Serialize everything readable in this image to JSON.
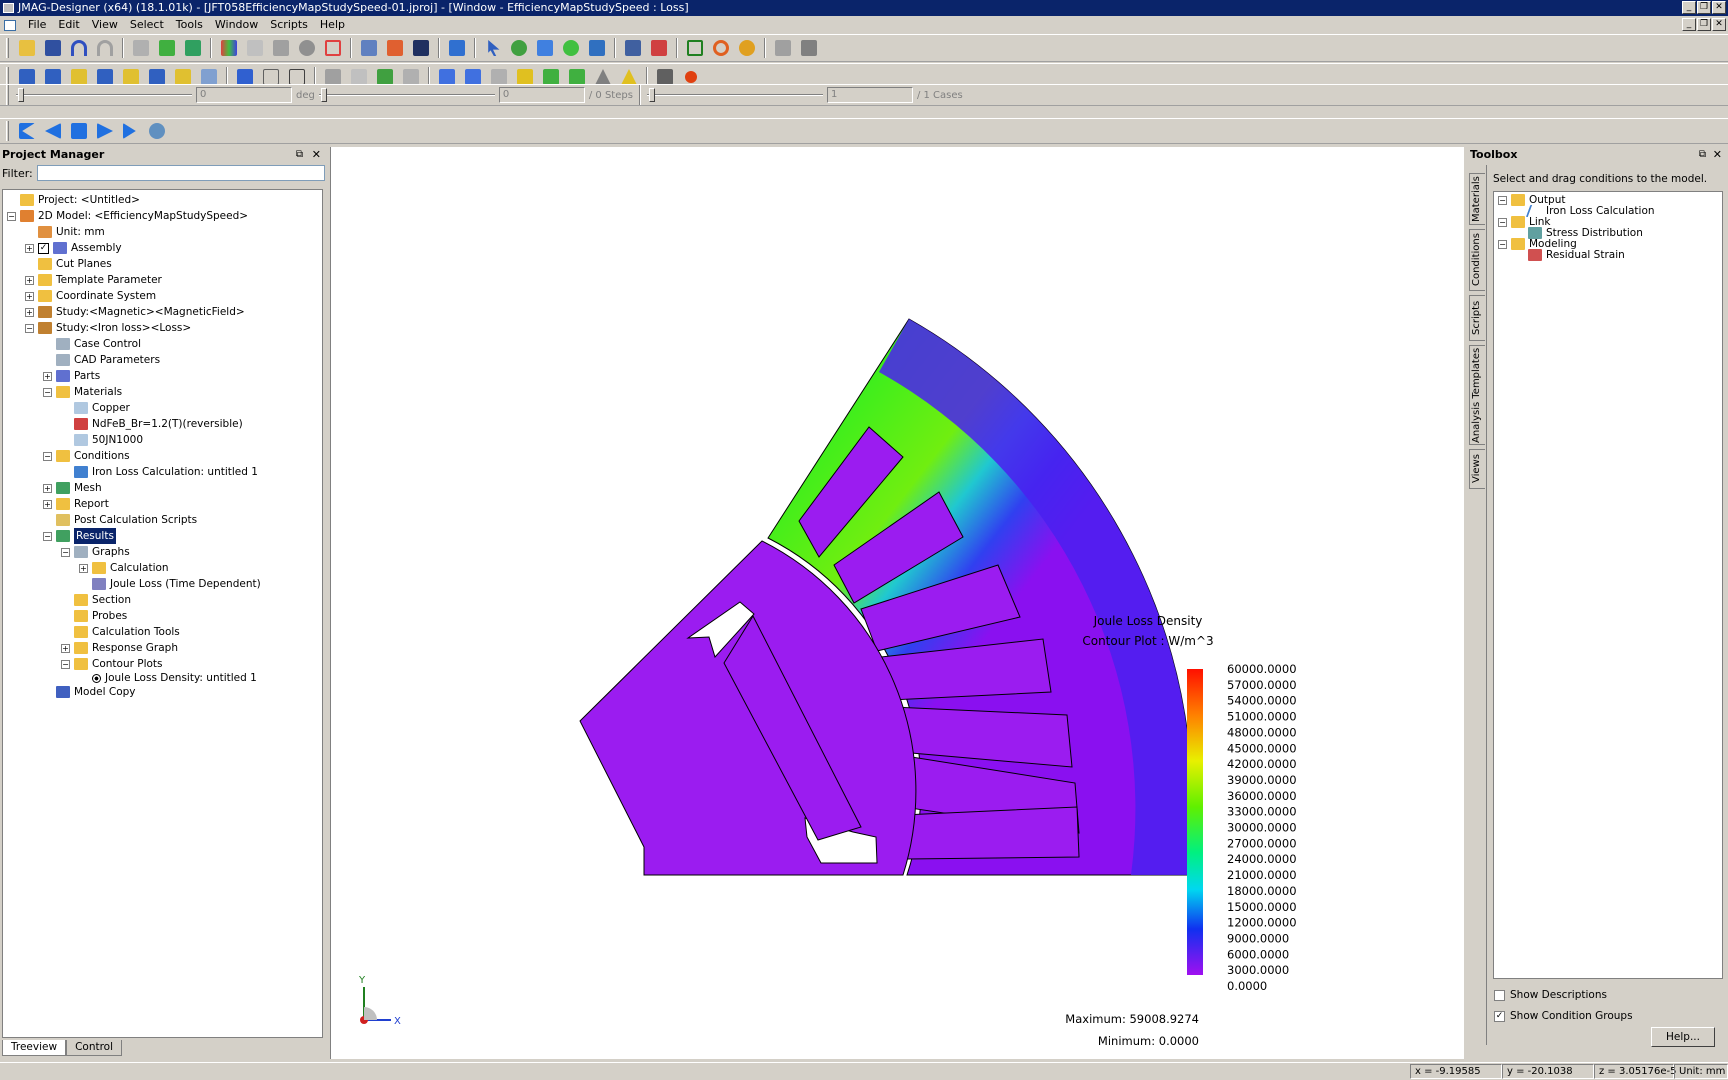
{
  "window": {
    "title": "JMAG-Designer (x64) (18.1.01k) - [JFT058EfficiencyMapStudySpeed-01.jproj] - [Window - EfficiencyMapStudySpeed : Loss]"
  },
  "menu": [
    "File",
    "Edit",
    "View",
    "Select",
    "Tools",
    "Window",
    "Scripts",
    "Help"
  ],
  "playback": {
    "angle_value": "0",
    "angle_unit": "deg",
    "step_value": "0",
    "steps_label": "/ 0 Steps",
    "case_value": "1",
    "cases_label": "/ 1 Cases"
  },
  "project_manager": {
    "title": "Project Manager",
    "filter_label": "Filter:",
    "filter_value": "",
    "tree": [
      {
        "label": "Project: <Untitled>",
        "icon": "folder",
        "color": "#f0c040"
      },
      {
        "label": "2D Model: <EfficiencyMapStudySpeed>",
        "icon": "model",
        "color": "#e08030"
      },
      {
        "label": "Unit: mm",
        "icon": "unit",
        "color": "#e09040"
      },
      {
        "label": "Assembly",
        "icon": "assembly",
        "color": "#6070d0"
      },
      {
        "label": "Cut Planes",
        "icon": "folder",
        "color": "#f0c040"
      },
      {
        "label": "Template Parameter",
        "icon": "folder",
        "color": "#f0c040"
      },
      {
        "label": "Coordinate System",
        "icon": "folder",
        "color": "#f0c040"
      },
      {
        "label": "Study:<Magnetic><MagneticField>",
        "icon": "study",
        "color": "#c08030"
      },
      {
        "label": "Study:<Iron loss><Loss>",
        "icon": "study",
        "color": "#c08030"
      },
      {
        "label": "Case Control",
        "icon": "table",
        "color": "#a0b0c0"
      },
      {
        "label": "CAD Parameters",
        "icon": "table",
        "color": "#a0b0c0"
      },
      {
        "label": "Parts",
        "icon": "parts",
        "color": "#6070d0"
      },
      {
        "label": "Materials",
        "icon": "materials",
        "color": "#f0c040"
      },
      {
        "label": "Copper",
        "icon": "material",
        "color": "#b0c8e0"
      },
      {
        "label": "NdFeB_Br=1.2(T)(reversible)",
        "icon": "material",
        "color": "#d04040"
      },
      {
        "label": "50JN1000",
        "icon": "material",
        "color": "#b0c8e0"
      },
      {
        "label": "Conditions",
        "icon": "conditions",
        "color": "#f0c040"
      },
      {
        "label": "Iron Loss Calculation: untitled 1",
        "icon": "condition",
        "color": "#4080d0"
      },
      {
        "label": "Mesh",
        "icon": "mesh",
        "color": "#40a060"
      },
      {
        "label": "Report",
        "icon": "report",
        "color": "#f0c040"
      },
      {
        "label": "Post Calculation Scripts",
        "icon": "scripts",
        "color": "#e0c060"
      },
      {
        "label": "Results",
        "icon": "results",
        "color": "#40a060"
      },
      {
        "label": "Graphs",
        "icon": "graphs",
        "color": "#a0b0c0"
      },
      {
        "label": "Calculation",
        "icon": "folder",
        "color": "#f0c040"
      },
      {
        "label": "Joule Loss (Time Dependent)",
        "icon": "graph",
        "color": "#8080c0"
      },
      {
        "label": "Section",
        "icon": "folder",
        "color": "#f0c040"
      },
      {
        "label": "Probes",
        "icon": "folder",
        "color": "#f0c040"
      },
      {
        "label": "Calculation Tools",
        "icon": "folder",
        "color": "#f0c040"
      },
      {
        "label": "Response Graph",
        "icon": "folder",
        "color": "#f0c040"
      },
      {
        "label": "Contour Plots",
        "icon": "folder",
        "color": "#f0c040"
      },
      {
        "label": "Joule Loss Density: untitled 1",
        "icon": "radio",
        "color": "#000000"
      },
      {
        "label": "Model Copy",
        "icon": "copy",
        "color": "#4060c0"
      }
    ],
    "tabs": [
      "Treeview",
      "Control"
    ]
  },
  "legend": {
    "title": "Joule Loss Density",
    "subtitle": "Contour Plot : W/m^3",
    "values": [
      "60000.0000",
      "57000.0000",
      "54000.0000",
      "51000.0000",
      "48000.0000",
      "45000.0000",
      "42000.0000",
      "39000.0000",
      "36000.0000",
      "33000.0000",
      "30000.0000",
      "27000.0000",
      "24000.0000",
      "21000.0000",
      "18000.0000",
      "15000.0000",
      "12000.0000",
      "9000.0000",
      "6000.0000",
      "3000.0000",
      "0.0000"
    ],
    "maximum": "Maximum: 59008.9274",
    "minimum": "Minimum: 0.0000"
  },
  "axes": {
    "x": "X",
    "y": "Y"
  },
  "toolbox": {
    "title": "Toolbox",
    "description": "Select and drag conditions to the model.",
    "vertical_tabs": [
      "Materials",
      "Conditions",
      "Scripts",
      "Analysis Templates",
      "Views"
    ],
    "tree": [
      {
        "label": "Output",
        "level": 0
      },
      {
        "label": "Iron Loss Calculation",
        "level": 1
      },
      {
        "label": "Link",
        "level": 0
      },
      {
        "label": "Stress Distribution",
        "level": 1
      },
      {
        "label": "Modeling",
        "level": 0
      },
      {
        "label": "Residual Strain",
        "level": 1
      }
    ],
    "show_descriptions": "Show Descriptions",
    "show_condition_groups": "Show Condition Groups",
    "help": "Help..."
  },
  "status": {
    "x": "x = -9.19585",
    "y": "y = -20.1038",
    "z": "z = 3.05176e-5",
    "unit": "Unit: mm"
  }
}
